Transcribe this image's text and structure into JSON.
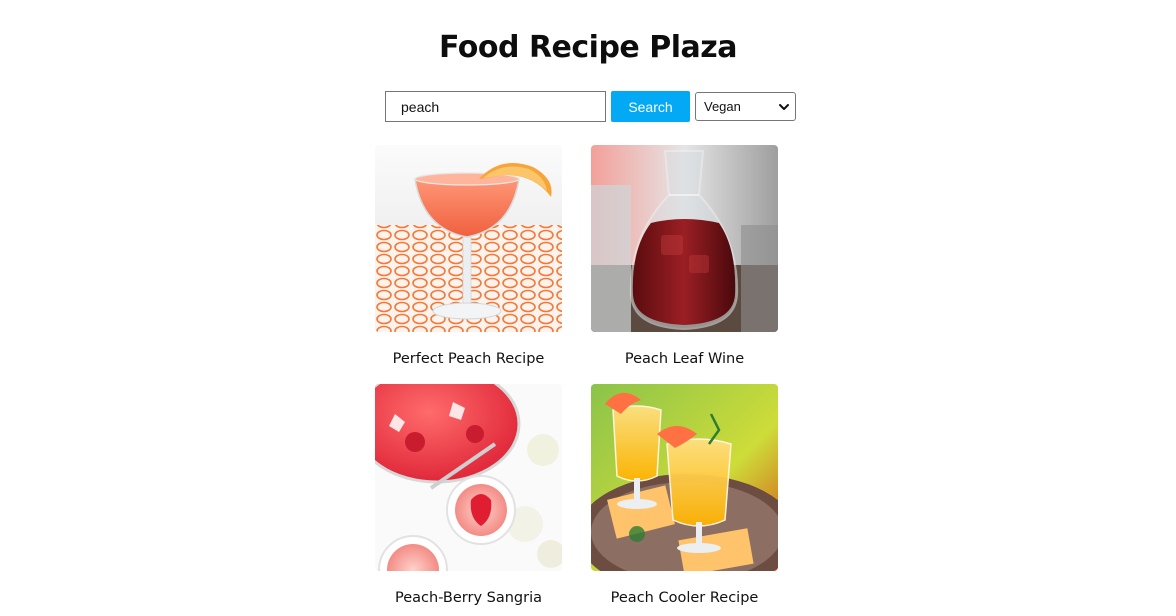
{
  "header": {
    "title": "Food Recipe Plaza"
  },
  "search": {
    "value": "peach",
    "button_label": "Search",
    "diet_selected": "Vegan"
  },
  "recipes": [
    {
      "title": "Perfect Peach Recipe",
      "image": "peach cocktail in coupe glass"
    },
    {
      "title": "Peach Leaf Wine",
      "image": "carafe of red wine"
    },
    {
      "title": "Peach-Berry Sangria",
      "image": "strawberry sangria punch bowl"
    },
    {
      "title": "Peach Cooler Recipe",
      "image": "orange cooler drinks with peach slices"
    }
  ],
  "colors": {
    "accent": "#03a9f4"
  }
}
